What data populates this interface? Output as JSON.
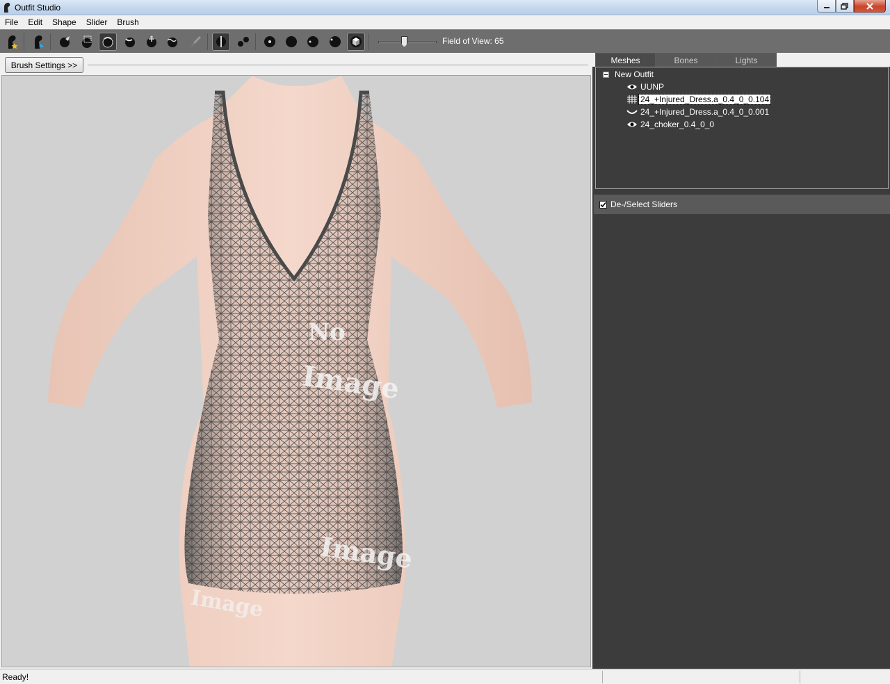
{
  "window": {
    "title": "Outfit Studio"
  },
  "menu": {
    "items": [
      "File",
      "Edit",
      "Shape",
      "Slider",
      "Brush"
    ]
  },
  "toolbar": {
    "fov_label": "Field of View: 65",
    "fov_value": 65
  },
  "brush_settings": {
    "label": "Brush Settings >>"
  },
  "tabs": [
    {
      "label": "Meshes",
      "active": true
    },
    {
      "label": "Bones",
      "active": false
    },
    {
      "label": "Lights",
      "active": false
    }
  ],
  "tree": {
    "root": "New Outfit",
    "items": [
      {
        "label": "UUNP",
        "icon": "eye-icon",
        "selected": false
      },
      {
        "label": "24_+Injured_Dress.a_0.4_0_0.104",
        "icon": "grid-icon",
        "selected": true
      },
      {
        "label": "24_+Injured_Dress.a_0.4_0_0.001",
        "icon": "closed-eye-icon",
        "selected": false
      },
      {
        "label": "24_choker_0.4_0_0",
        "icon": "eye-icon",
        "selected": false
      }
    ]
  },
  "sliders": {
    "header": "De-/Select Sliders",
    "checked": true
  },
  "status": {
    "text": "Ready!"
  },
  "viewport": {
    "watermark_texts": [
      "No",
      "Image",
      "Image",
      "Image"
    ]
  }
}
